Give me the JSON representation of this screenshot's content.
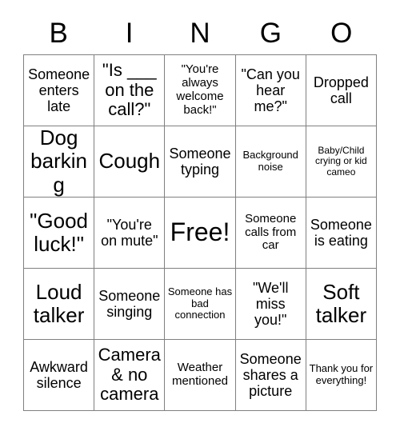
{
  "header": {
    "letters": [
      "B",
      "I",
      "N",
      "G",
      "O"
    ]
  },
  "grid": {
    "rows": 5,
    "columns": 5,
    "border_color": "#808080",
    "background_color": "#ffffff",
    "text_color": "#000000",
    "cells": [
      {
        "text": "Someone enters late",
        "size": "md"
      },
      {
        "text": "\"Is ___ on the call?\"",
        "size": "lg"
      },
      {
        "text": "\"You're always welcome back!\"",
        "size": "sm"
      },
      {
        "text": "\"Can you hear me?\"",
        "size": "md"
      },
      {
        "text": "Dropped call",
        "size": "md"
      },
      {
        "text": "Dog barking",
        "size": "xl"
      },
      {
        "text": "Cough",
        "size": "xl"
      },
      {
        "text": "Someone typing",
        "size": "md"
      },
      {
        "text": "Background noise",
        "size": "xs"
      },
      {
        "text": "Baby/Child crying or kid cameo",
        "size": "xxs"
      },
      {
        "text": "\"Good luck!\"",
        "size": "xl"
      },
      {
        "text": "\"You're on mute\"",
        "size": "md"
      },
      {
        "text": "Free!",
        "size": "xxl"
      },
      {
        "text": "Someone calls from car",
        "size": "sm"
      },
      {
        "text": "Someone is eating",
        "size": "md"
      },
      {
        "text": "Loud talker",
        "size": "xl"
      },
      {
        "text": "Someone singing",
        "size": "md"
      },
      {
        "text": "Someone has bad connection",
        "size": "xs"
      },
      {
        "text": "\"We'll miss you!\"",
        "size": "md"
      },
      {
        "text": "Soft talker",
        "size": "xl"
      },
      {
        "text": "Awkward silence",
        "size": "md"
      },
      {
        "text": "Camera & no camera",
        "size": "lg"
      },
      {
        "text": "Weather mentioned",
        "size": "sm"
      },
      {
        "text": "Someone shares a picture",
        "size": "md"
      },
      {
        "text": "Thank you for everything!",
        "size": "xs"
      }
    ]
  }
}
